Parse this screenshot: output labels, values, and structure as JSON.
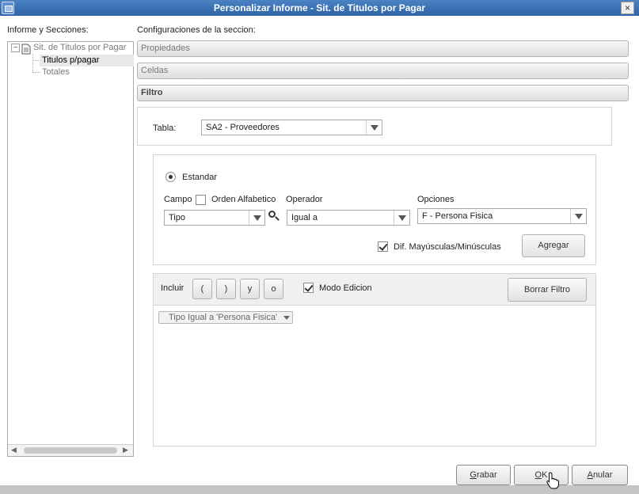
{
  "window": {
    "title": "Personalizar Informe - Sit. de Titulos por Pagar",
    "close_label": "×"
  },
  "left": {
    "label": "Informe y Secciones:",
    "tree": [
      {
        "label": "Sit. de Titulos por Pagar",
        "expander": "−"
      },
      {
        "label": "Titulos p/pagar"
      },
      {
        "label": "Totales"
      }
    ],
    "scroll_left": "◀",
    "scroll_right": "▶"
  },
  "config": {
    "label": "Configuraciones de la seccion:",
    "sections": [
      "Propiedades",
      "Celdas",
      "Filtro"
    ]
  },
  "filter": {
    "tabla_label": "Tabla:",
    "tabla_value": "SA2 - Proveedores",
    "standard_label": "Estandar",
    "campo_label": "Campo",
    "orden_label": "Orden Alfabetico",
    "campo_value": "Tipo",
    "operador_label": "Operador",
    "operador_value": "Igual a",
    "opciones_label": "Opciones",
    "opciones_value": "F - Persona Fisica",
    "case_label": "Dif. Mayúsculas/Minúsculas",
    "agregar_label": "Agregar",
    "incluir_label": "Incluir",
    "incluir_buttons": [
      "(",
      ")",
      "y",
      "o"
    ],
    "modo_label": "Modo Edicion",
    "borrar_label": "Borrar Filtro",
    "expression": "Tipo Igual a 'Persona Fisica'"
  },
  "footer": {
    "grabar_prefix": "G",
    "grabar_rest": "rabar",
    "ok_prefix": "O",
    "ok_rest": "K",
    "anular_prefix": "A",
    "anular_rest": "nular"
  }
}
